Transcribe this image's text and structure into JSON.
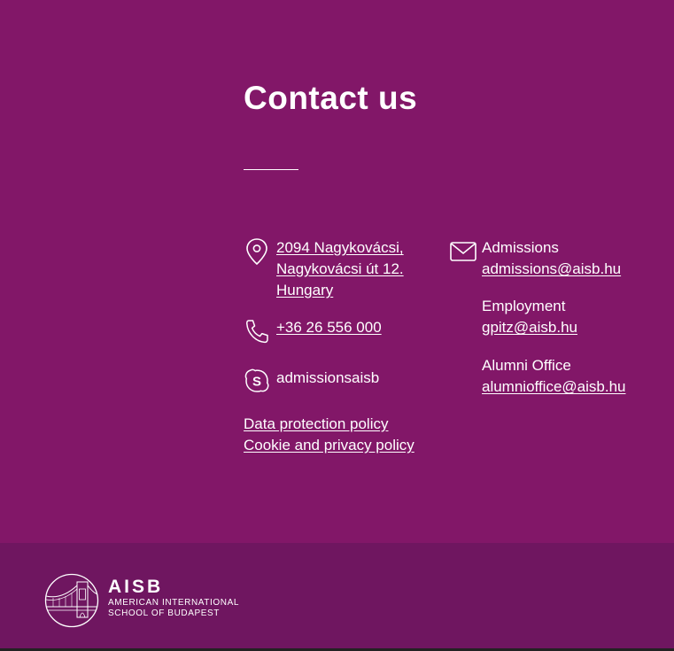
{
  "page": {
    "background_color": "#821768",
    "footer_color": "#6f1660"
  },
  "contact": {
    "title": "Contact us",
    "address": {
      "line1": "2094 Nagykovácsi,",
      "line2": "Nagykovácsi út 12.",
      "line3": "Hungary",
      "icon": "map-pin-icon"
    },
    "phone": {
      "value": "+36 26 556 000",
      "icon": "phone-icon"
    },
    "skype": {
      "value": "admissionsaisb",
      "icon": "skype-icon"
    },
    "policies": [
      "Data protection policy",
      "Cookie and privacy policy"
    ],
    "email_icon": "envelope-icon",
    "emails": [
      {
        "label": "Admissions",
        "address": "admissions@aisb.hu"
      },
      {
        "label": "Employment",
        "address": "gpitz@aisb.hu"
      },
      {
        "label": "Alumni Office",
        "address": "alumnioffice@aisb.hu"
      }
    ]
  },
  "footer": {
    "logo_name": "AISB",
    "logo_line1": "AMERICAN INTERNATIONAL",
    "logo_line2": "SCHOOL OF BUDAPEST"
  }
}
